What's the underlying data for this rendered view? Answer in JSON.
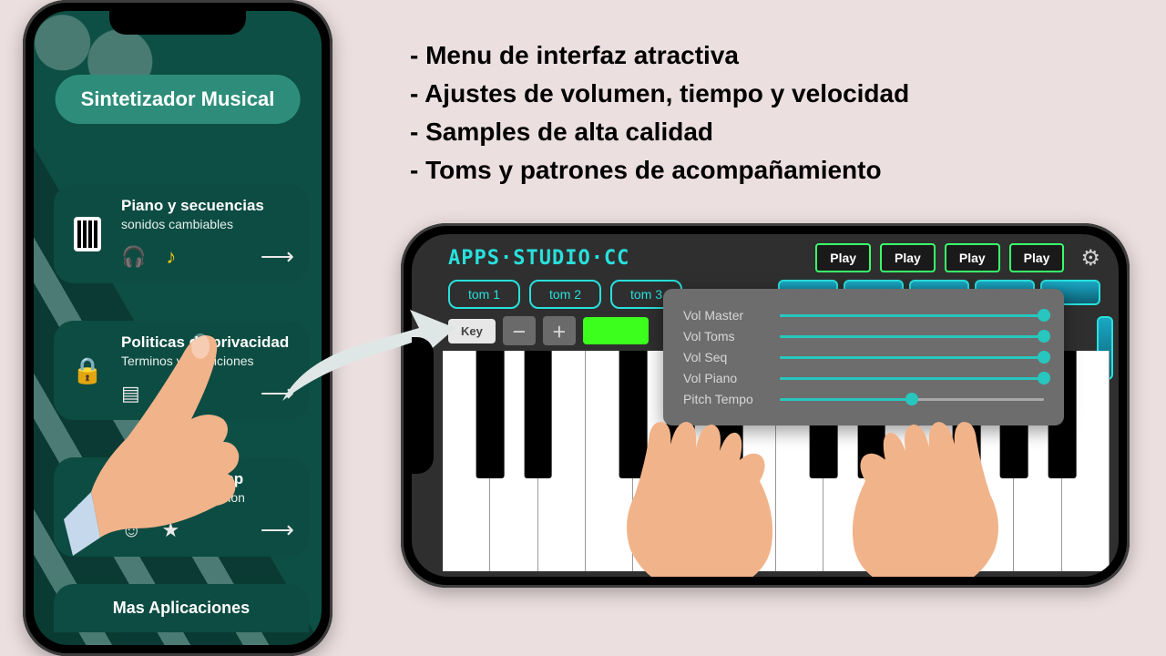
{
  "features": [
    "- Menu de interfaz atractiva",
    "- Ajustes de volumen, tiempo y velocidad",
    "- Samples de alta calidad",
    "- Toms y patrones de acompañamiento"
  ],
  "left_phone": {
    "title": "Sintetizador Musical",
    "cards": [
      {
        "title": "Piano y secuencias",
        "subtitle": "sonidos cambiables"
      },
      {
        "title": "Politicas de privacidad",
        "subtitle": "Terminos y condiciones"
      },
      {
        "title": "Califica esta app",
        "subtitle": "Valora esta aplicacion"
      }
    ],
    "more": "Mas Aplicaciones"
  },
  "right_phone": {
    "logo": "APPS·STUDIO·CC",
    "play_label": "Play",
    "toms": [
      "tom 1",
      "tom 2",
      "tom 3"
    ],
    "key_label": "Key",
    "sliders": [
      {
        "label": "Vol Master",
        "value": 100
      },
      {
        "label": "Vol Toms",
        "value": 100
      },
      {
        "label": "Vol Seq",
        "value": 100
      },
      {
        "label": "Vol Piano",
        "value": 100
      },
      {
        "label": "Pitch Tempo",
        "value": 50
      }
    ]
  }
}
